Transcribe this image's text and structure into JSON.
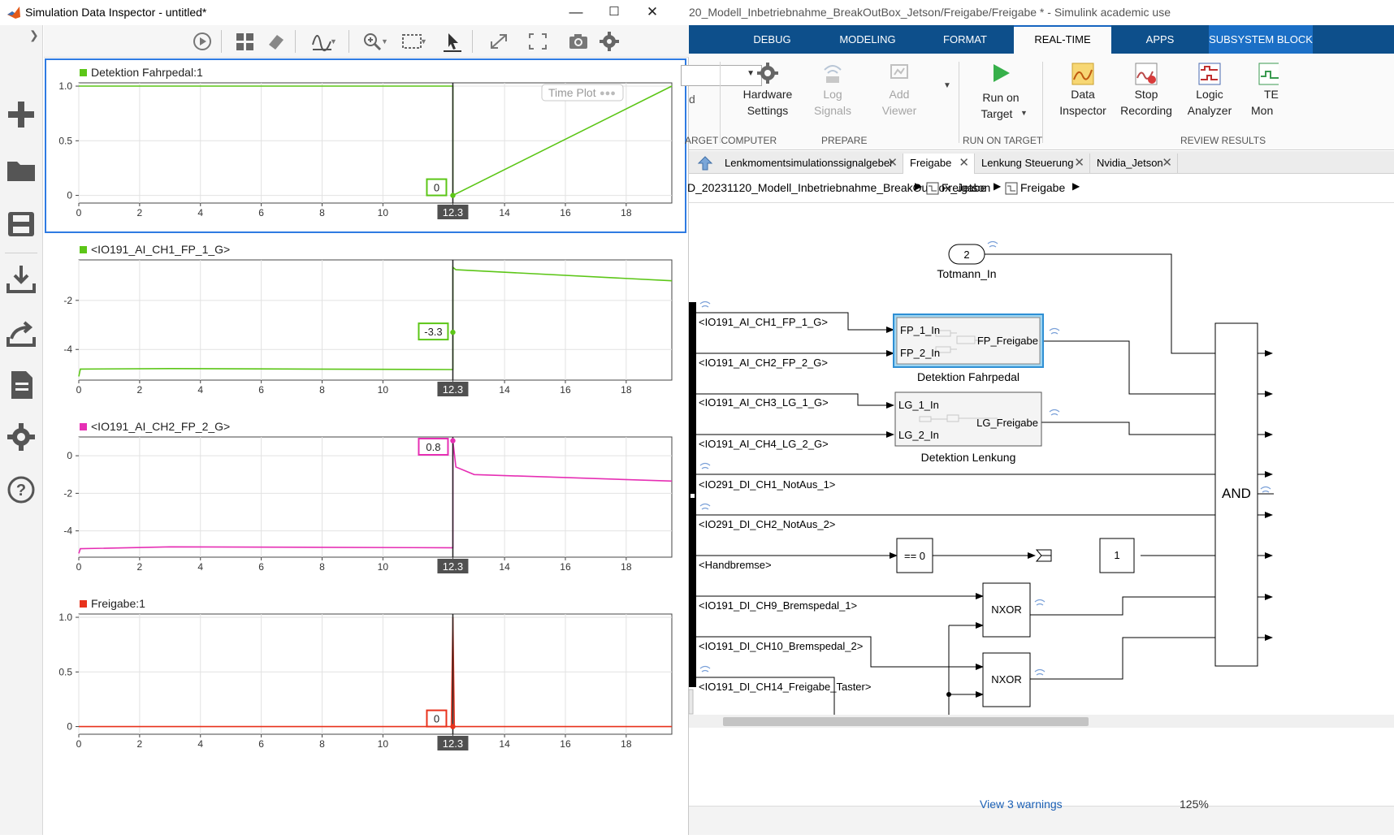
{
  "sdi": {
    "title": "Simulation Data Inspector - untitled*",
    "window_controls": {
      "minimize": "—",
      "maximize": "☐",
      "close": "✕"
    },
    "time_plot_label": "Time Plot",
    "x_ticks": [
      "0",
      "2",
      "4",
      "6",
      "8",
      "10",
      "12.3",
      "14",
      "16",
      "18"
    ],
    "cursor_time": "12.3"
  },
  "chart_data": [
    {
      "type": "line",
      "title": "Detektion Fahrpedal:1",
      "color": "#5cc617",
      "xlim": [
        0,
        19.5
      ],
      "ylim": [
        -0.07,
        1.03
      ],
      "y_ticks": [
        "1.0",
        "0.5",
        "0"
      ],
      "y_tick_values": [
        1.0,
        0.5,
        0
      ],
      "x": [
        0,
        12.3,
        12.3,
        19.5
      ],
      "y": [
        1,
        1,
        0,
        1
      ],
      "cursor_value": "0",
      "cursor_y": 0
    },
    {
      "type": "line",
      "title": "<IO191_AI_CH1_FP_1_G>",
      "color": "#5cc617",
      "xlim": [
        0,
        19.5
      ],
      "ylim": [
        -5.25,
        -0.35
      ],
      "y_ticks": [
        "-2",
        "-4"
      ],
      "y_tick_values": [
        -2,
        -4
      ],
      "x": [
        0,
        0.05,
        3,
        12.25,
        12.3,
        12.3,
        12.4,
        19.5
      ],
      "y": [
        -5.1,
        -4.8,
        -4.78,
        -4.82,
        -4.82,
        -0.65,
        -0.75,
        -1.2
      ],
      "cursor_value": "-3.3",
      "cursor_y": -3.3
    },
    {
      "type": "line",
      "title": "<IO191_AI_CH2_FP_2_G>",
      "color": "#e62fb4",
      "xlim": [
        0,
        19.5
      ],
      "ylim": [
        -5.4,
        1.0
      ],
      "y_ticks": [
        "0",
        "-2",
        "-4"
      ],
      "y_tick_values": [
        0,
        -2,
        -4
      ],
      "x": [
        0,
        0.05,
        3,
        12.25,
        12.3,
        12.3,
        12.4,
        13,
        19.5
      ],
      "y": [
        -5.2,
        -4.95,
        -4.85,
        -4.9,
        -4.9,
        0.8,
        -0.6,
        -1.0,
        -1.35
      ],
      "cursor_value": "0.8",
      "cursor_y": 0.8
    },
    {
      "type": "line",
      "title": "Freigabe:1",
      "color": "#e8321c",
      "xlim": [
        0,
        19.5
      ],
      "ylim": [
        -0.07,
        1.03
      ],
      "y_ticks": [
        "1.0",
        "0.5",
        "0"
      ],
      "y_tick_values": [
        1.0,
        0.5,
        0
      ],
      "x": [
        0,
        12.25,
        12.3,
        12.35,
        12.4,
        19.5
      ],
      "y": [
        0,
        0,
        1,
        0,
        0,
        0
      ],
      "cursor_value": "0",
      "cursor_y": 0
    }
  ],
  "simulink": {
    "title": "20_Modell_Inbetriebnahme_BreakOutBox_Jetson/Freigabe/Freigabe * - Simulink academic use",
    "tabs": [
      "DEBUG",
      "MODELING",
      "FORMAT",
      "REAL-TIME",
      "APPS",
      "SUBSYSTEM BLOCK"
    ],
    "active_tab": "REAL-TIME",
    "ribbon": {
      "hardware_settings": [
        "Hardware",
        "Settings"
      ],
      "log_signals": [
        "Log",
        "Signals"
      ],
      "add_viewer": [
        "Add",
        "Viewer"
      ],
      "run_on_target": [
        "Run on",
        "Target"
      ],
      "data_inspector": [
        "Data",
        "Inspector"
      ],
      "stop_recording": [
        "Stop",
        "Recording"
      ],
      "logic_analyzer": [
        "Logic",
        "Analyzer"
      ],
      "te_monitor": [
        "TE",
        "Mon"
      ],
      "sections": [
        "ARGET COMPUTER",
        "PREPARE",
        "RUN ON TARGET",
        "REVIEW RESULTS"
      ],
      "partial_label": "d"
    },
    "doc_tabs": [
      "Lenkmomentsimulationssignalgeber",
      "Freigabe",
      "Lenkung Steuerung",
      "Nvidia_Jetson"
    ],
    "active_doc_tab": "Freigabe",
    "breadcrumb": [
      "D_20231120_Modell_Inbetriebnahme_BreakOutBox_Jetson",
      "Freigabe",
      "Freigabe"
    ],
    "signals": [
      "<IO191_AI_CH1_FP_1_G>",
      "<IO191_AI_CH2_FP_2_G>",
      "<IO191_AI_CH3_LG_1_G>",
      "<IO191_AI_CH4_LG_2_G>",
      "<IO291_DI_CH1_NotAus_1>",
      "<IO291_DI_CH2_NotAus_2>",
      "<Handbremse>",
      "<IO191_DI_CH9_Bremspedal_1>",
      "<IO191_DI_CH10_Bremspedal_2>",
      "<IO191_DI_CH14_Freigabe_Taster>"
    ],
    "blocks": {
      "inport_number": "2",
      "inport_name": "Totmann_In",
      "fp_in1": "FP_1_In",
      "fp_in2": "FP_2_In",
      "fp_out": "FP_Freigabe",
      "fp_name": "Detektion Fahrpedal",
      "lg_in1": "LG_1_In",
      "lg_in2": "LG_2_In",
      "lg_out": "LG_Freigabe",
      "lg_name": "Detektion Lenkung",
      "compare": "== 0",
      "constant": "1",
      "nxor1": "NXOR",
      "nxor2": "NXOR",
      "and": "AND"
    },
    "status": {
      "warnings": "View 3 warnings",
      "zoom": "125%"
    }
  }
}
